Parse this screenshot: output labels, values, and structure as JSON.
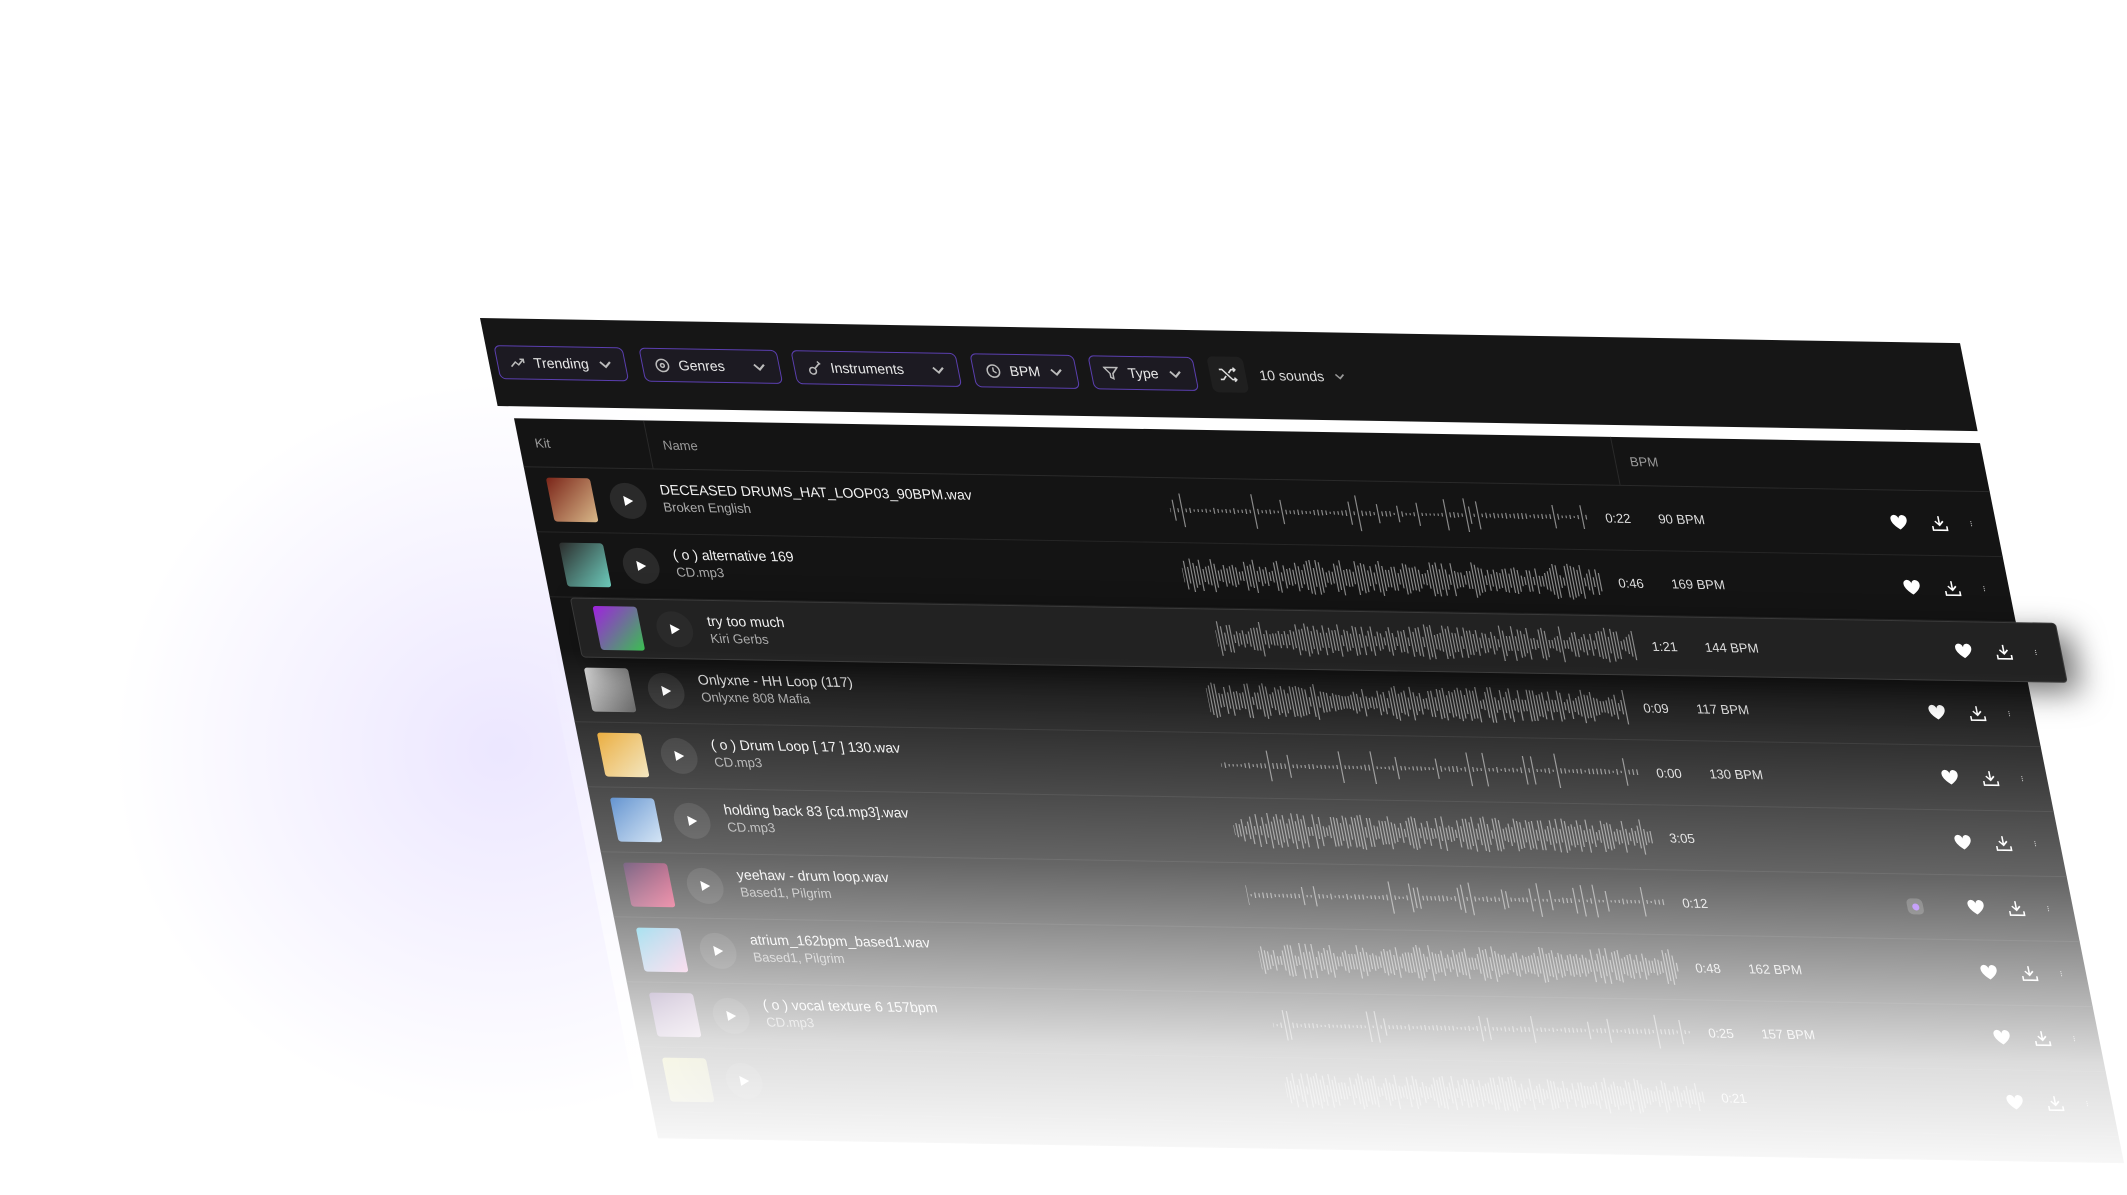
{
  "toolbar": {
    "filters": [
      {
        "label": "Trending",
        "icon": "trending-icon"
      },
      {
        "label": "Genres",
        "icon": "genres-icon"
      },
      {
        "label": "Instruments",
        "icon": "guitar-icon"
      },
      {
        "label": "BPM",
        "icon": "clock-icon"
      },
      {
        "label": "Type",
        "icon": "filter-icon"
      }
    ],
    "shuffle_icon": "shuffle-icon",
    "count_label": "10 sounds"
  },
  "table": {
    "headers": {
      "kit": "Kit",
      "name": "Name",
      "bpm": "BPM"
    },
    "rows": [
      {
        "title": "DECEASED DRUMS_HAT_LOOP03_90BPM.wav",
        "subtitle": "Broken English",
        "duration": "0:22",
        "bpm": "90 BPM",
        "art": [
          "#7a2418",
          "#d9b98a"
        ]
      },
      {
        "title": "( o ) alternative 169",
        "subtitle": "CD.mp3",
        "duration": "0:46",
        "bpm": "169 BPM",
        "art": [
          "#2b2b2b",
          "#6fd0c0"
        ]
      },
      {
        "title": "try too much",
        "subtitle": "Kiri Gerbs",
        "duration": "1:21",
        "bpm": "144 BPM",
        "art": [
          "#a020e0",
          "#3ac050"
        ],
        "highlighted": true
      },
      {
        "title": "Onlyxne - HH Loop (117)",
        "subtitle": "Onlyxne 808 Mafia",
        "duration": "0:09",
        "bpm": "117 BPM",
        "art": [
          "#ddd",
          "#555"
        ]
      },
      {
        "title": "( o ) Drum Loop [ 17 ] 130.wav",
        "subtitle": "CD.mp3",
        "duration": "0:00",
        "bpm": "130 BPM",
        "art": [
          "#e8a020",
          "#f0e0b0"
        ]
      },
      {
        "title": "holding back 83 [cd.mp3].wav",
        "subtitle": "CD.mp3",
        "duration": "3:05",
        "bpm": "",
        "art": [
          "#3070c0",
          "#c0d8f0"
        ]
      },
      {
        "title": "yeehaw - drum loop.wav",
        "subtitle": "Based1, Pilgrim",
        "duration": "0:12",
        "bpm": "",
        "art": [
          "#301040",
          "#e03060"
        ],
        "dot": true
      },
      {
        "title": "atrium_162bpm_based1.wav",
        "subtitle": "Based1, Pilgrim",
        "duration": "0:48",
        "bpm": "162 BPM",
        "art": [
          "#40c0e0",
          "#f0a0d0"
        ]
      },
      {
        "title": "( o ) vocal texture 6 157bpm",
        "subtitle": "CD.mp3",
        "duration": "0:25",
        "bpm": "157 BPM",
        "art": [
          "#604080",
          "#c0a0c0"
        ]
      },
      {
        "title": "",
        "subtitle": "",
        "duration": "0:21",
        "bpm": "",
        "art": [
          "#c0c040",
          "#808040"
        ]
      }
    ]
  },
  "colors": {
    "accent": "#5b3fb0",
    "dot": "#9b5cf6"
  }
}
